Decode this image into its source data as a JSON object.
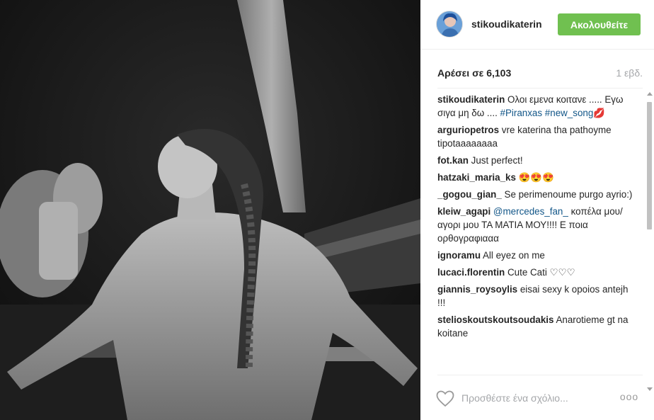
{
  "post": {
    "photo_icon": "photo-image",
    "username": "stikoudikaterin",
    "follow_label": "Ακολουθείτε",
    "likes_text": "Αρέσει σε 6,103",
    "time_text": "1 εβδ."
  },
  "comments": [
    {
      "user": "stikoudikaterin",
      "text": "Ολοι εμενα κοιτανε ..... Εγω σιγα μη δω .... ",
      "tags": [
        "#Piranxas",
        "#new_song"
      ],
      "emoji": "💋"
    },
    {
      "user": "arguriopetros",
      "text": "vre katerina tha pathoyme tipotaaaaaaaa"
    },
    {
      "user": "fot.kan",
      "text": "Just perfect!"
    },
    {
      "user": "hatzaki_maria_ks",
      "text": "😍😍😍"
    },
    {
      "user": "_gogou_gian_",
      "text": "Se perimenoume purgo ayrio:)"
    },
    {
      "user": "kleiw_agapi",
      "mention": "@mercedes_fan_",
      "text": "κοπέλα μου/αγορι μου ΤΑ ΜΑΤΙΑ ΜΟΥ!!!! Ε ποια ορθογραφιααα"
    },
    {
      "user": "ignoramu",
      "text": "All eyez on me"
    },
    {
      "user": "lucaci.florentin",
      "text": "Cute Cati ♡♡♡"
    },
    {
      "user": "giannis_roysoylis",
      "text": "eisai sexy k opoios antejh !!!"
    },
    {
      "user": "stelioskoutskoutsoudakis",
      "text": "Anarotieme gt na koitane"
    }
  ],
  "composer": {
    "placeholder": "Προσθέστε ένα σχόλιο...",
    "heart_icon": "heart-outline",
    "more_label": "ooo"
  },
  "colors": {
    "follow_green": "#70c050",
    "link_blue": "#125688",
    "muted": "#a5a7aa"
  }
}
